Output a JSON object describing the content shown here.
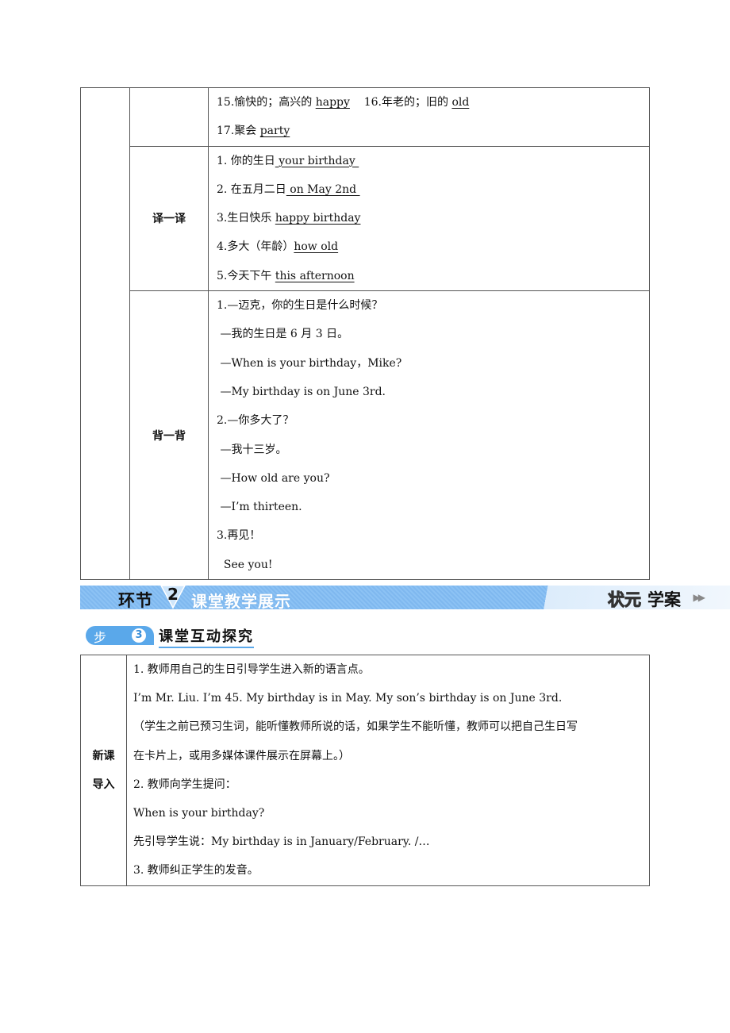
{
  "vocab_table": {
    "rows": [
      {
        "label": "",
        "lines": [
          {
            "parts": [
              {
                "t": "15.愉快的；高兴的 "
              },
              {
                "t": "happy",
                "u": true
              },
              {
                "t": "    16.年老的；旧的 "
              },
              {
                "t": "old",
                "u": true
              }
            ]
          },
          {
            "parts": [
              {
                "t": "17.聚会 "
              },
              {
                "t": "party",
                "u": true
              }
            ]
          }
        ]
      },
      {
        "label": "译一译",
        "lines": [
          {
            "parts": [
              {
                "t": "1. 你的生日"
              },
              {
                "t": " your birthday ",
                "u": true
              }
            ]
          },
          {
            "parts": [
              {
                "t": "2. 在五月二日"
              },
              {
                "t": " on May 2nd ",
                "u": true
              }
            ]
          },
          {
            "parts": [
              {
                "t": "3.生日快乐 "
              },
              {
                "t": "happy birthday",
                "u": true
              }
            ]
          },
          {
            "parts": [
              {
                "t": "4.多大（年龄）"
              },
              {
                "t": "how old",
                "u": true
              }
            ]
          },
          {
            "parts": [
              {
                "t": "5.今天下午 "
              },
              {
                "t": "this afternoon",
                "u": true
              }
            ]
          }
        ]
      },
      {
        "label": "背一背",
        "lines": [
          {
            "parts": [
              {
                "t": "1.—迈克，你的生日是什么时候？"
              }
            ]
          },
          {
            "parts": [
              {
                "t": " —我的生日是 6 月 3 日。"
              }
            ]
          },
          {
            "parts": [
              {
                "t": " —When is your birthday，Mike?"
              }
            ]
          },
          {
            "parts": [
              {
                "t": " —My birthday is on June 3rd."
              }
            ]
          },
          {
            "parts": [
              {
                "t": "2.—你多大了？"
              }
            ]
          },
          {
            "parts": [
              {
                "t": " —我十三岁。"
              }
            ]
          },
          {
            "parts": [
              {
                "t": " —How old are you?"
              }
            ]
          },
          {
            "parts": [
              {
                "t": " —I’m thirteen."
              }
            ]
          },
          {
            "parts": [
              {
                "t": "3.再见！"
              }
            ]
          },
          {
            "parts": [
              {
                "t": "  See you!"
              }
            ]
          }
        ]
      }
    ]
  },
  "section_banner": {
    "prefix": "环节",
    "number": "2",
    "title": "课堂教学展示",
    "brand_outline": "状元",
    "brand_solid": "学案",
    "arrows": "▶▶",
    "colors": {
      "banner": "#8cc2f4",
      "step": "#5aa8ea"
    }
  },
  "step": {
    "label": "步骤",
    "number": "3",
    "title": "课堂互动探究"
  },
  "intro_table": {
    "label_line1": "新课",
    "label_line2": "导入",
    "lines": [
      "1. 教师用自己的生日引导学生进入新的语言点。",
      "I’m Mr. Liu. I’m 45. My birthday is in May. My son’s birthday is on June 3rd.",
      "（学生之前已预习生词，能听懂教师所说的话，如果学生不能听懂，教师可以把自己生日写",
      "在卡片上，或用多媒体课件展示在屏幕上。）",
      "2. 教师向学生提问：",
      "When is your birthday?",
      "先引导学生说：My birthday is in January/February. /…",
      "3. 教师纠正学生的发音。"
    ]
  }
}
